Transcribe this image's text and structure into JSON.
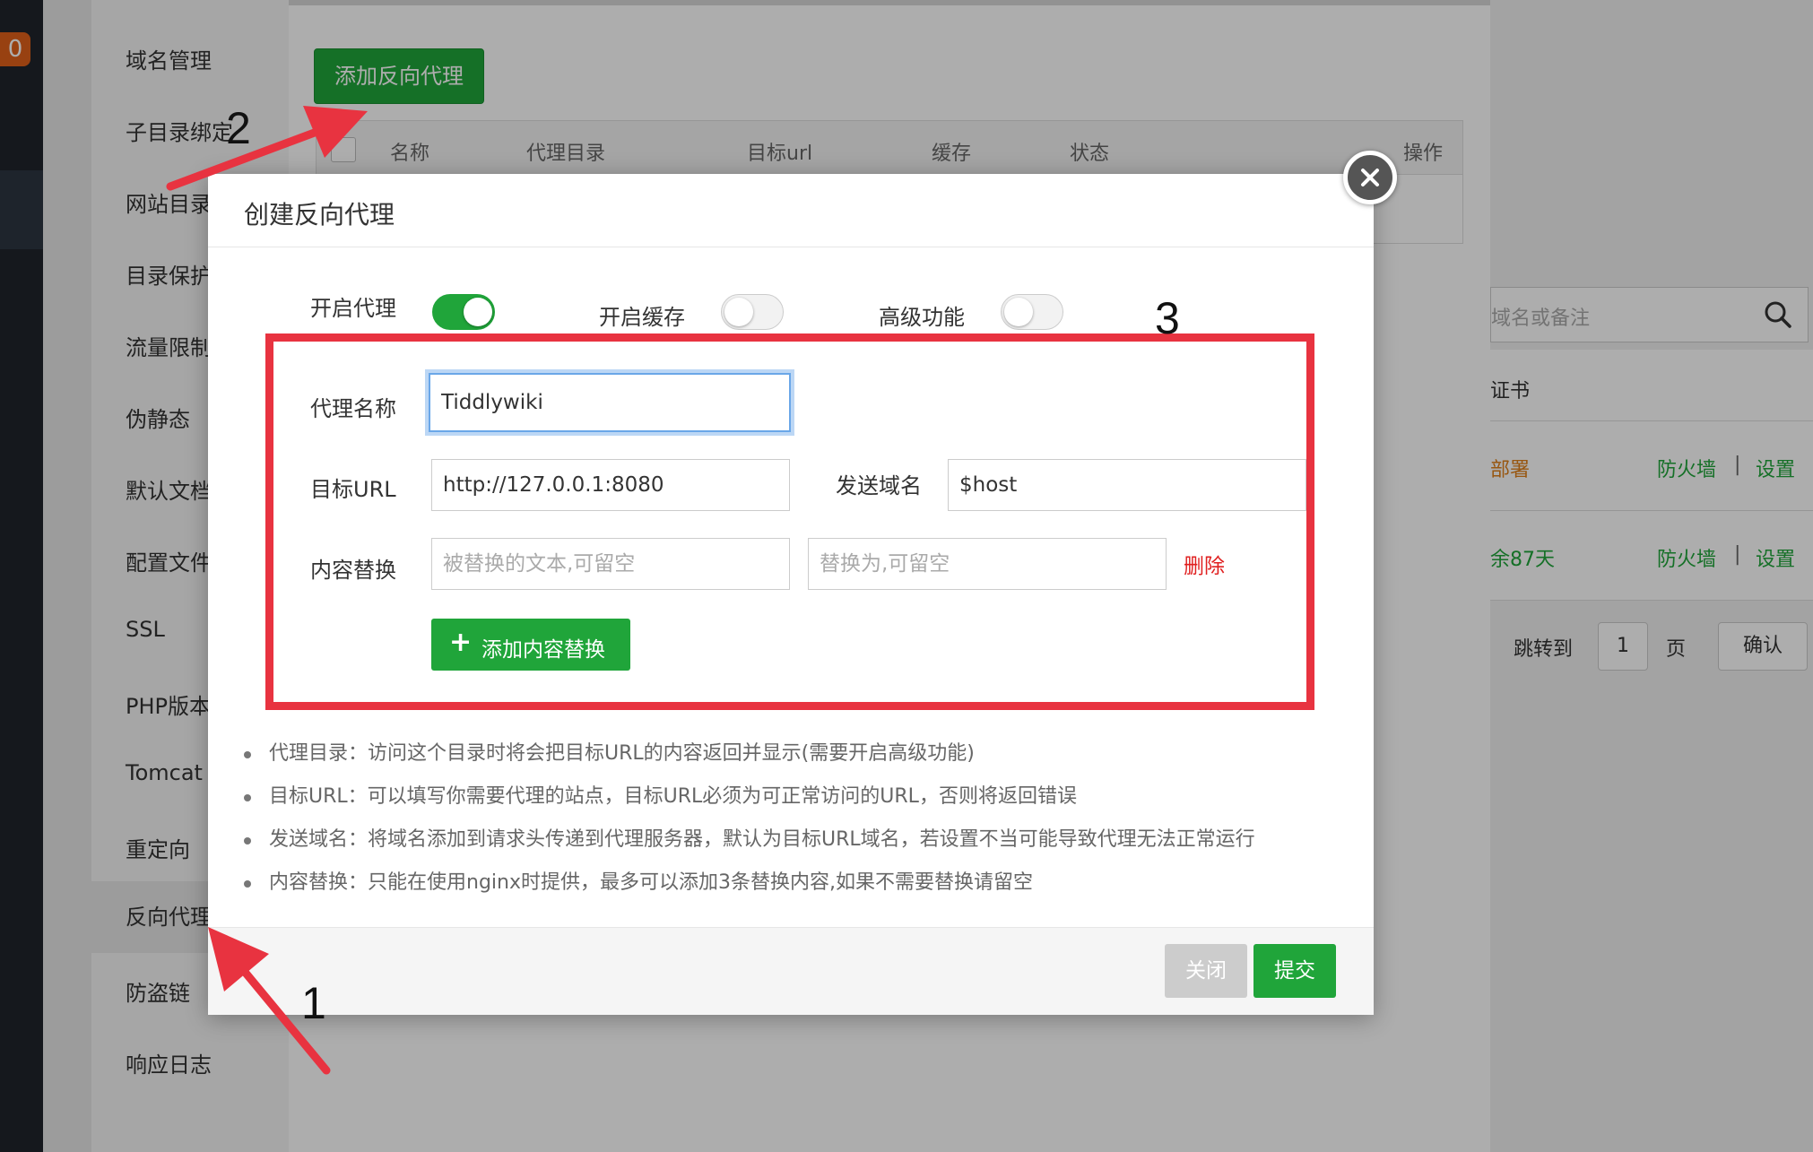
{
  "sidebar_badge": "0",
  "settings_menu": [
    "域名管理",
    "子目录绑定",
    "网站目录",
    "目录保护",
    "流量限制",
    "伪静态",
    "默认文档",
    "配置文件",
    "SSL",
    "PHP版本",
    "Tomcat",
    "重定向",
    "反向代理",
    "防盗链",
    "响应日志"
  ],
  "page": {
    "add_proxy_button": "添加反向代理",
    "table_columns": [
      "名称",
      "代理目录",
      "目标url",
      "缓存",
      "状态",
      "操作"
    ]
  },
  "right_panel": {
    "search_placeholder": "域名或备注",
    "row_ssl": "证书",
    "row1_text": "部署",
    "row2_text": "余87天",
    "firewall": "防火墙",
    "separator": "|",
    "settings": "设置",
    "jump_to": "跳转到",
    "page_input": "1",
    "page_unit": "页",
    "confirm": "确认"
  },
  "modal": {
    "title": "创建反向代理",
    "toggles": [
      {
        "label": "开启代理",
        "on": true
      },
      {
        "label": "开启缓存",
        "on": false
      },
      {
        "label": "高级功能",
        "on": false
      }
    ],
    "proxy_name_label": "代理名称",
    "proxy_name_value": "Tiddlywiki",
    "target_url_label": "目标URL",
    "target_url_value": "http://127.0.0.1:8080",
    "send_domain_label": "发送域名",
    "send_domain_value": "$host",
    "content_replace_label": "内容替换",
    "replace_from_placeholder": "被替换的文本,可留空",
    "replace_to_placeholder": "替换为,可留空",
    "delete_link": "删除",
    "add_replace_button": "添加内容替换",
    "help": [
      "代理目录：访问这个目录时将会把目标URL的内容返回并显示(需要开启高级功能)",
      "目标URL：可以填写你需要代理的站点，目标URL必须为可正常访问的URL，否则将返回错误",
      "发送域名：将域名添加到请求头传递到代理服务器，默认为目标URL域名，若设置不当可能导致代理无法正常运行",
      "内容替换：只能在使用nginx时提供，最多可以添加3条替换内容,如果不需要替换请留空"
    ],
    "close_button": "关闭",
    "submit_button": "提交"
  },
  "annotations": {
    "step1": "1",
    "step2": "2",
    "step3": "3"
  },
  "colors": {
    "accent_green": "#20a53a",
    "annotation_red": "#e83340",
    "delete_red": "#e02020",
    "focus_blue": "#6aa7e8"
  }
}
